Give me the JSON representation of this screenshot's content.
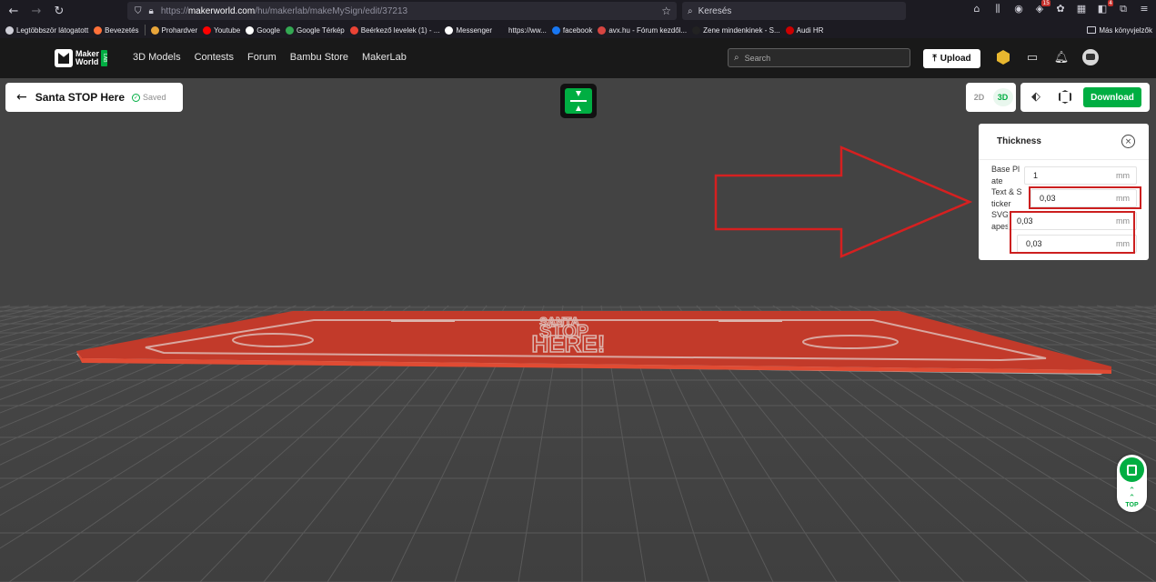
{
  "browser": {
    "url_prefix": "https://",
    "url_host": "makerworld.com",
    "url_path": "/hu/makerlab/makeMySign/edit/37213",
    "search_placeholder": "Keresés",
    "tool_badge_1": "15",
    "tool_badge_2": "4"
  },
  "bookmarks": {
    "items": [
      {
        "label": "Legtöbbször látogatott",
        "color": "#cfcfd8"
      },
      {
        "label": "Bevezetés",
        "color": "#ff7139"
      },
      {
        "label": "Prohardver",
        "color": "#e8a53a"
      },
      {
        "label": "Youtube",
        "color": "#ff0000"
      },
      {
        "label": "Google",
        "color": "#ffffff"
      },
      {
        "label": "Google Térkép",
        "color": "#34a853"
      },
      {
        "label": "Beérkező levelek (1) - ...",
        "color": "#ea4335"
      },
      {
        "label": "Messenger",
        "color": "#ffffff"
      },
      {
        "label": "https://ww...",
        "color": "#1c1b22"
      },
      {
        "label": "facebook",
        "color": "#1877f2"
      },
      {
        "label": "avx.hu - Fórum kezdől...",
        "color": "#d64541"
      },
      {
        "label": "Zene mindenkinek - S...",
        "color": "#222222"
      },
      {
        "label": "Audi HR",
        "color": "#cc0000"
      }
    ],
    "other": "Más könyvjelzők"
  },
  "site": {
    "logo_line1": "Maker",
    "logo_line2": "World",
    "logo_badge": "LAB",
    "nav": [
      "3D Models",
      "Contests",
      "Forum",
      "Bambu Store",
      "MakerLab"
    ],
    "search_placeholder": "Search",
    "upload_label": "Upload"
  },
  "editor": {
    "title": "Santa STOP Here",
    "saved": "Saved",
    "view_2d": "2D",
    "view_3d": "3D",
    "active_view": "3D",
    "download_label": "Download",
    "sign_lines": [
      "SANTA",
      "STOP",
      "HERE!"
    ]
  },
  "thickness": {
    "title": "Thickness",
    "rows": [
      {
        "label": "Base Plate",
        "value": "1",
        "unit": "mm"
      },
      {
        "label": "Text & Sticker",
        "value": "0,03",
        "unit": "mm"
      },
      {
        "label": "SVG Shapes",
        "value": "0,03",
        "unit": "mm"
      },
      {
        "label": "",
        "value": "0,03",
        "unit": "mm"
      }
    ]
  },
  "fab": {
    "top_label": "TOP"
  },
  "colors": {
    "accent": "#00ae42",
    "sign_red": "#c0392b",
    "highlight": "#cc1f1f"
  }
}
